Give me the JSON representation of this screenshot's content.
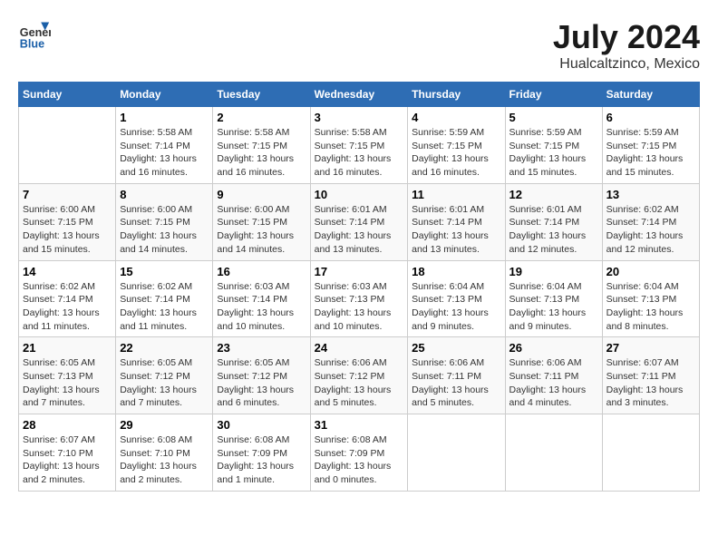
{
  "logo": {
    "general": "General",
    "blue": "Blue"
  },
  "title": "July 2024",
  "subtitle": "Hualcaltzinco, Mexico",
  "days_of_week": [
    "Sunday",
    "Monday",
    "Tuesday",
    "Wednesday",
    "Thursday",
    "Friday",
    "Saturday"
  ],
  "weeks": [
    [
      {
        "day": "",
        "info": ""
      },
      {
        "day": "1",
        "info": "Sunrise: 5:58 AM\nSunset: 7:14 PM\nDaylight: 13 hours\nand 16 minutes."
      },
      {
        "day": "2",
        "info": "Sunrise: 5:58 AM\nSunset: 7:15 PM\nDaylight: 13 hours\nand 16 minutes."
      },
      {
        "day": "3",
        "info": "Sunrise: 5:58 AM\nSunset: 7:15 PM\nDaylight: 13 hours\nand 16 minutes."
      },
      {
        "day": "4",
        "info": "Sunrise: 5:59 AM\nSunset: 7:15 PM\nDaylight: 13 hours\nand 16 minutes."
      },
      {
        "day": "5",
        "info": "Sunrise: 5:59 AM\nSunset: 7:15 PM\nDaylight: 13 hours\nand 15 minutes."
      },
      {
        "day": "6",
        "info": "Sunrise: 5:59 AM\nSunset: 7:15 PM\nDaylight: 13 hours\nand 15 minutes."
      }
    ],
    [
      {
        "day": "7",
        "info": "Sunrise: 6:00 AM\nSunset: 7:15 PM\nDaylight: 13 hours\nand 15 minutes."
      },
      {
        "day": "8",
        "info": "Sunrise: 6:00 AM\nSunset: 7:15 PM\nDaylight: 13 hours\nand 14 minutes."
      },
      {
        "day": "9",
        "info": "Sunrise: 6:00 AM\nSunset: 7:15 PM\nDaylight: 13 hours\nand 14 minutes."
      },
      {
        "day": "10",
        "info": "Sunrise: 6:01 AM\nSunset: 7:14 PM\nDaylight: 13 hours\nand 13 minutes."
      },
      {
        "day": "11",
        "info": "Sunrise: 6:01 AM\nSunset: 7:14 PM\nDaylight: 13 hours\nand 13 minutes."
      },
      {
        "day": "12",
        "info": "Sunrise: 6:01 AM\nSunset: 7:14 PM\nDaylight: 13 hours\nand 12 minutes."
      },
      {
        "day": "13",
        "info": "Sunrise: 6:02 AM\nSunset: 7:14 PM\nDaylight: 13 hours\nand 12 minutes."
      }
    ],
    [
      {
        "day": "14",
        "info": "Sunrise: 6:02 AM\nSunset: 7:14 PM\nDaylight: 13 hours\nand 11 minutes."
      },
      {
        "day": "15",
        "info": "Sunrise: 6:02 AM\nSunset: 7:14 PM\nDaylight: 13 hours\nand 11 minutes."
      },
      {
        "day": "16",
        "info": "Sunrise: 6:03 AM\nSunset: 7:14 PM\nDaylight: 13 hours\nand 10 minutes."
      },
      {
        "day": "17",
        "info": "Sunrise: 6:03 AM\nSunset: 7:13 PM\nDaylight: 13 hours\nand 10 minutes."
      },
      {
        "day": "18",
        "info": "Sunrise: 6:04 AM\nSunset: 7:13 PM\nDaylight: 13 hours\nand 9 minutes."
      },
      {
        "day": "19",
        "info": "Sunrise: 6:04 AM\nSunset: 7:13 PM\nDaylight: 13 hours\nand 9 minutes."
      },
      {
        "day": "20",
        "info": "Sunrise: 6:04 AM\nSunset: 7:13 PM\nDaylight: 13 hours\nand 8 minutes."
      }
    ],
    [
      {
        "day": "21",
        "info": "Sunrise: 6:05 AM\nSunset: 7:13 PM\nDaylight: 13 hours\nand 7 minutes."
      },
      {
        "day": "22",
        "info": "Sunrise: 6:05 AM\nSunset: 7:12 PM\nDaylight: 13 hours\nand 7 minutes."
      },
      {
        "day": "23",
        "info": "Sunrise: 6:05 AM\nSunset: 7:12 PM\nDaylight: 13 hours\nand 6 minutes."
      },
      {
        "day": "24",
        "info": "Sunrise: 6:06 AM\nSunset: 7:12 PM\nDaylight: 13 hours\nand 5 minutes."
      },
      {
        "day": "25",
        "info": "Sunrise: 6:06 AM\nSunset: 7:11 PM\nDaylight: 13 hours\nand 5 minutes."
      },
      {
        "day": "26",
        "info": "Sunrise: 6:06 AM\nSunset: 7:11 PM\nDaylight: 13 hours\nand 4 minutes."
      },
      {
        "day": "27",
        "info": "Sunrise: 6:07 AM\nSunset: 7:11 PM\nDaylight: 13 hours\nand 3 minutes."
      }
    ],
    [
      {
        "day": "28",
        "info": "Sunrise: 6:07 AM\nSunset: 7:10 PM\nDaylight: 13 hours\nand 2 minutes."
      },
      {
        "day": "29",
        "info": "Sunrise: 6:08 AM\nSunset: 7:10 PM\nDaylight: 13 hours\nand 2 minutes."
      },
      {
        "day": "30",
        "info": "Sunrise: 6:08 AM\nSunset: 7:09 PM\nDaylight: 13 hours\nand 1 minute."
      },
      {
        "day": "31",
        "info": "Sunrise: 6:08 AM\nSunset: 7:09 PM\nDaylight: 13 hours\nand 0 minutes."
      },
      {
        "day": "",
        "info": ""
      },
      {
        "day": "",
        "info": ""
      },
      {
        "day": "",
        "info": ""
      }
    ]
  ]
}
